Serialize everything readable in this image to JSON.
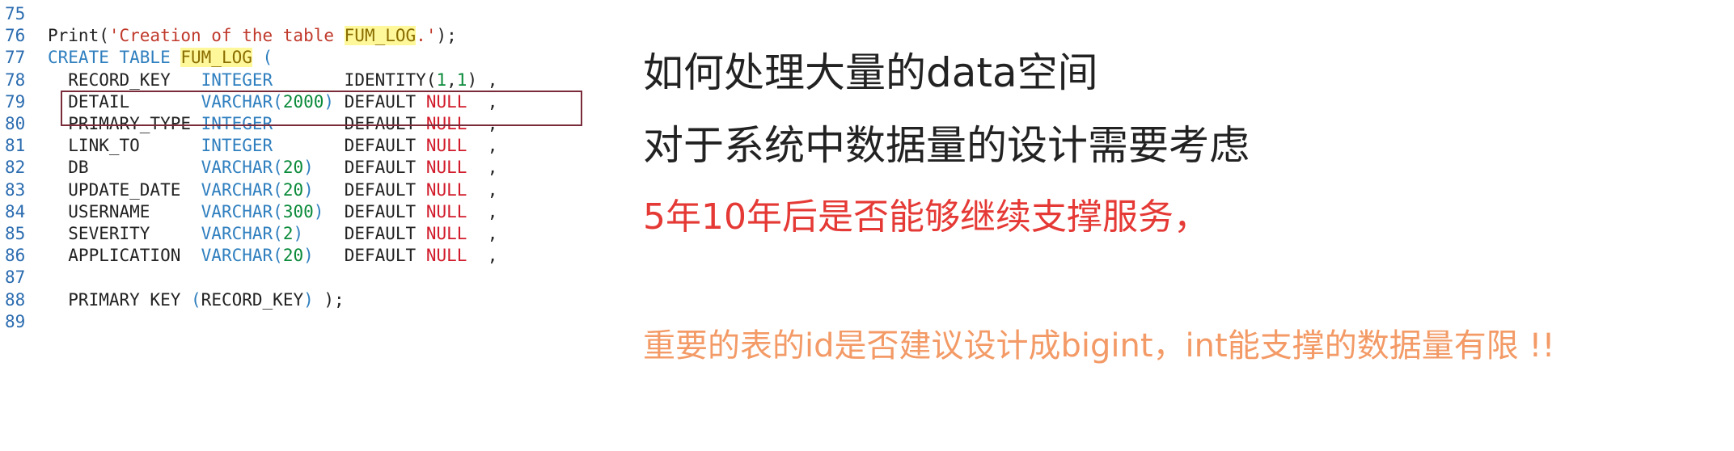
{
  "editor": {
    "line_numbers": [
      "75",
      "76",
      "77",
      "78",
      "79",
      "80",
      "81",
      "82",
      "83",
      "84",
      "85",
      "86",
      "87",
      "88",
      "89"
    ],
    "lines": [
      {
        "segments": []
      },
      {
        "segments": [
          {
            "t": "Print(",
            "c": "tok-name"
          },
          {
            "t": "'Creation of the table ",
            "c": "tok-str"
          },
          {
            "t": "FUM_LOG",
            "c": "tok-hl"
          },
          {
            "t": ".'",
            "c": "tok-str"
          },
          {
            "t": ");",
            "c": "tok-name"
          }
        ]
      },
      {
        "segments": [
          {
            "t": "CREATE TABLE ",
            "c": "tok-kw"
          },
          {
            "t": "FUM_LOG",
            "c": "tok-hl"
          },
          {
            "t": " (",
            "c": "tok-paren"
          }
        ]
      },
      {
        "segments": [
          {
            "t": "  RECORD_KEY   ",
            "c": "tok-name"
          },
          {
            "t": "INTEGER",
            "c": "tok-kw"
          },
          {
            "t": "       IDENTITY(",
            "c": "tok-name"
          },
          {
            "t": "1",
            "c": "tok-num"
          },
          {
            "t": ",",
            "c": "tok-name"
          },
          {
            "t": "1",
            "c": "tok-num"
          },
          {
            "t": ") ,",
            "c": "tok-name"
          }
        ]
      },
      {
        "segments": [
          {
            "t": "  DETAIL       ",
            "c": "tok-name"
          },
          {
            "t": "VARCHAR(",
            "c": "tok-kw"
          },
          {
            "t": "2000",
            "c": "tok-num"
          },
          {
            "t": ")",
            "c": "tok-kw"
          },
          {
            "t": " DEFAULT ",
            "c": "tok-name"
          },
          {
            "t": "NULL",
            "c": "tok-null"
          },
          {
            "t": "  ,",
            "c": "tok-name"
          }
        ]
      },
      {
        "segments": [
          {
            "t": "  PRIMARY_TYPE ",
            "c": "tok-name"
          },
          {
            "t": "INTEGER",
            "c": "tok-kw"
          },
          {
            "t": "       DEFAULT ",
            "c": "tok-name"
          },
          {
            "t": "NULL",
            "c": "tok-null"
          },
          {
            "t": "  ,",
            "c": "tok-name"
          }
        ]
      },
      {
        "segments": [
          {
            "t": "  LINK_TO      ",
            "c": "tok-name"
          },
          {
            "t": "INTEGER",
            "c": "tok-kw"
          },
          {
            "t": "       DEFAULT ",
            "c": "tok-name"
          },
          {
            "t": "NULL",
            "c": "tok-null"
          },
          {
            "t": "  ,",
            "c": "tok-name"
          }
        ]
      },
      {
        "segments": [
          {
            "t": "  DB           ",
            "c": "tok-name"
          },
          {
            "t": "VARCHAR(",
            "c": "tok-kw"
          },
          {
            "t": "20",
            "c": "tok-num"
          },
          {
            "t": ")",
            "c": "tok-kw"
          },
          {
            "t": "   DEFAULT ",
            "c": "tok-name"
          },
          {
            "t": "NULL",
            "c": "tok-null"
          },
          {
            "t": "  ,",
            "c": "tok-name"
          }
        ]
      },
      {
        "segments": [
          {
            "t": "  UPDATE_DATE  ",
            "c": "tok-name"
          },
          {
            "t": "VARCHAR(",
            "c": "tok-kw"
          },
          {
            "t": "20",
            "c": "tok-num"
          },
          {
            "t": ")",
            "c": "tok-kw"
          },
          {
            "t": "   DEFAULT ",
            "c": "tok-name"
          },
          {
            "t": "NULL",
            "c": "tok-null"
          },
          {
            "t": "  ,",
            "c": "tok-name"
          }
        ]
      },
      {
        "segments": [
          {
            "t": "  USERNAME     ",
            "c": "tok-name"
          },
          {
            "t": "VARCHAR(",
            "c": "tok-kw"
          },
          {
            "t": "300",
            "c": "tok-num"
          },
          {
            "t": ")",
            "c": "tok-kw"
          },
          {
            "t": "  DEFAULT ",
            "c": "tok-name"
          },
          {
            "t": "NULL",
            "c": "tok-null"
          },
          {
            "t": "  ,",
            "c": "tok-name"
          }
        ]
      },
      {
        "segments": [
          {
            "t": "  SEVERITY     ",
            "c": "tok-name"
          },
          {
            "t": "VARCHAR(",
            "c": "tok-kw"
          },
          {
            "t": "2",
            "c": "tok-num"
          },
          {
            "t": ")",
            "c": "tok-kw"
          },
          {
            "t": "    DEFAULT ",
            "c": "tok-name"
          },
          {
            "t": "NULL",
            "c": "tok-null"
          },
          {
            "t": "  ,",
            "c": "tok-name"
          }
        ]
      },
      {
        "segments": [
          {
            "t": "  APPLICATION  ",
            "c": "tok-name"
          },
          {
            "t": "VARCHAR(",
            "c": "tok-kw"
          },
          {
            "t": "20",
            "c": "tok-num"
          },
          {
            "t": ")",
            "c": "tok-kw"
          },
          {
            "t": "   DEFAULT ",
            "c": "tok-name"
          },
          {
            "t": "NULL",
            "c": "tok-null"
          },
          {
            "t": "  ,",
            "c": "tok-name"
          }
        ]
      },
      {
        "segments": []
      },
      {
        "segments": [
          {
            "t": "  PRIMARY KEY ",
            "c": "tok-name"
          },
          {
            "t": "(",
            "c": "tok-paren"
          },
          {
            "t": "RECORD_KEY",
            "c": "tok-name"
          },
          {
            "t": ")",
            "c": "tok-paren"
          },
          {
            "t": " );",
            "c": "tok-name"
          }
        ]
      },
      {
        "segments": []
      }
    ]
  },
  "notes": {
    "line1": "如何处理大量的data空间",
    "line2": "对于系统中数据量的设计需要考虑",
    "line3": "5年10年后是否能够继续支撑服务，",
    "line4": "重要的表的id是否建议设计成bigint，int能支撑的数据量有限 !!"
  },
  "colors": {
    "keyword": "#2f7fbf",
    "string": "#c0392b",
    "number": "#0a8a3a",
    "null": "#d11a2a",
    "highlight": "#fff89a",
    "line_numbers": "#2b6cb0",
    "selection_box": "#7a2b3a",
    "note_red": "#e53935",
    "note_orange": "#f39a66"
  }
}
